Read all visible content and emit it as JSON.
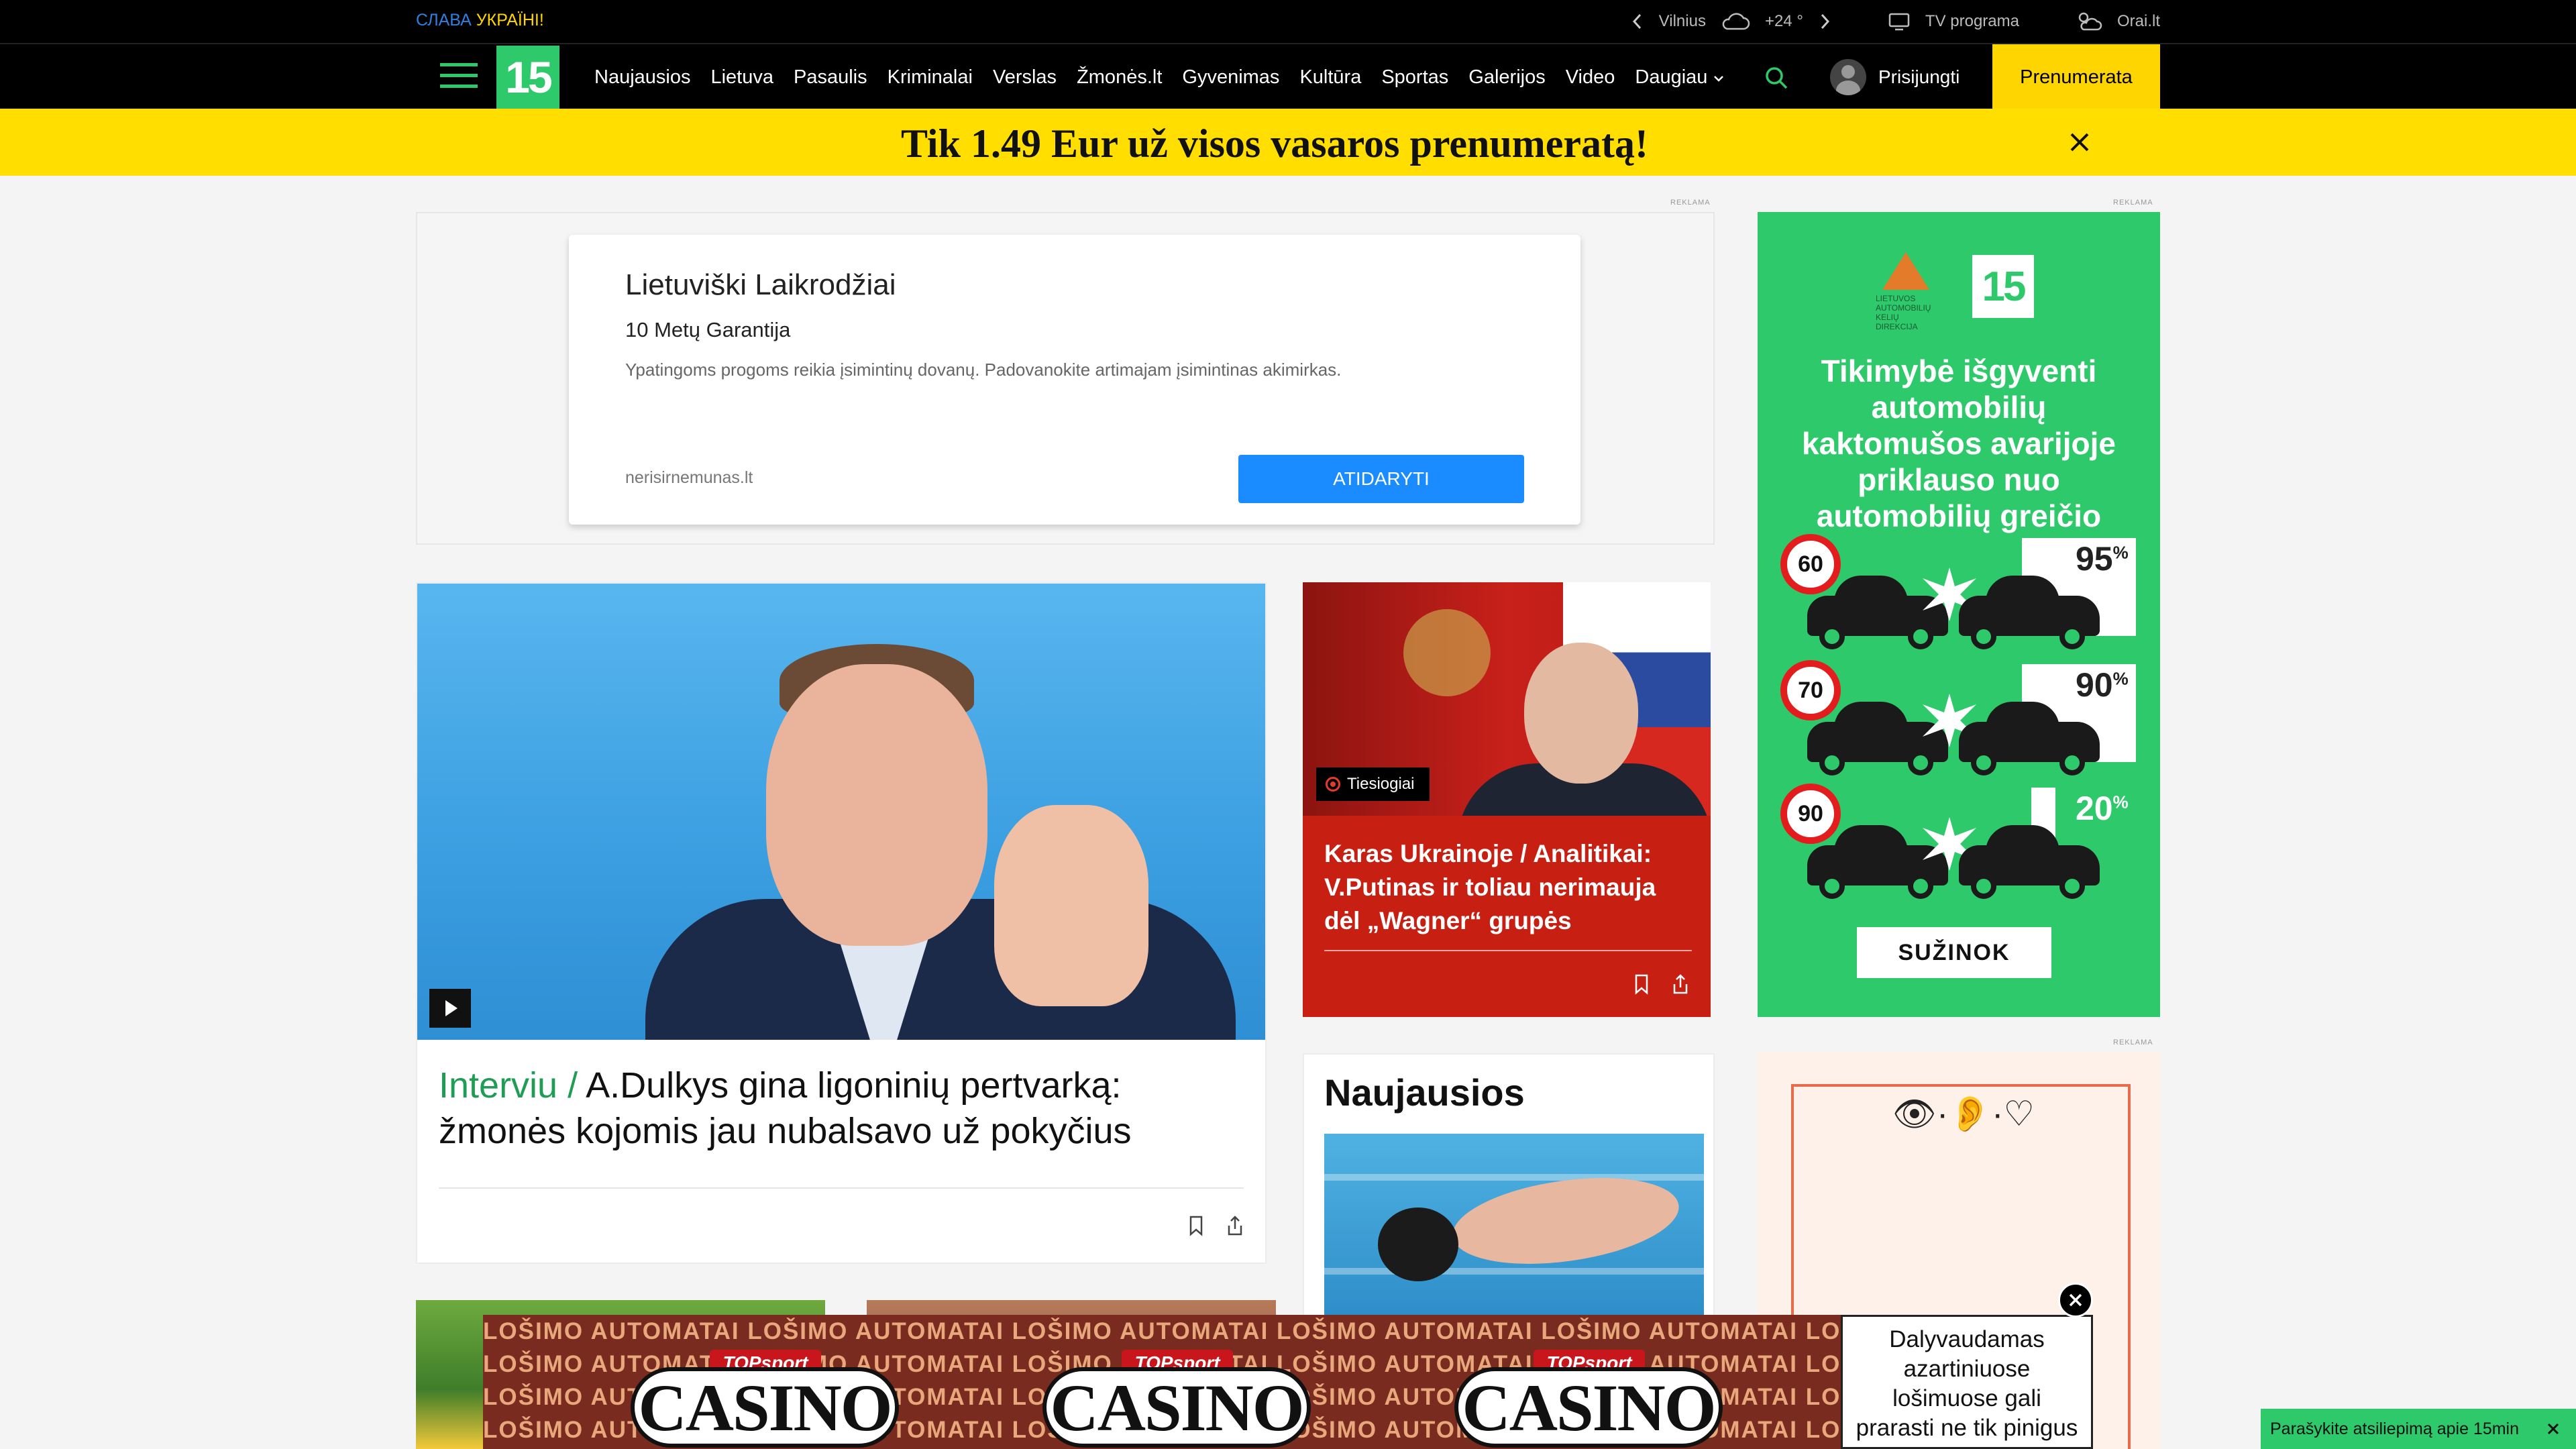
{
  "topbar": {
    "slava_blue": "СЛАВА",
    "slava_yellow": "УКРАЇНІ!",
    "weather_city": "Vilnius",
    "weather_temp": "+24 °",
    "tv_label": "TV programa",
    "orai_label": "Orai.lt"
  },
  "nav": {
    "logo": "15",
    "items": [
      "Naujausios",
      "Lietuva",
      "Pasaulis",
      "Kriminalai",
      "Verslas",
      "Žmonės.lt",
      "Gyvenimas",
      "Kultūra",
      "Sportas",
      "Galerijos",
      "Video",
      "Daugiau"
    ],
    "login": "Prisijungti",
    "subscribe": "Prenumerata"
  },
  "promo": {
    "text": "Tik 1.49 Eur už visos vasaros prenumeratą!"
  },
  "ad_label": "REKLAMA",
  "ad": {
    "title": "Lietuviški Laikrodžiai",
    "subtitle": "10 Metų Garantija",
    "description": "Ypatingoms progoms reikia įsimintinų dovanų. Padovanokite artimajam įsimintinas akimirkas.",
    "domain": "nerisirnemunas.lt",
    "button": "ATIDARYTI"
  },
  "main_article": {
    "category": "Interviu /",
    "title": "A.Dulkys gina ligoninių pertvarką: žmonės kojomis jau nubalsavo už pokyčius"
  },
  "live_article": {
    "badge": "Tiesiogiai",
    "title": "Karas Ukrainoje / Analitikai: V.Putinas ir toliau nerimauja dėl „Wagner“ grupės"
  },
  "naujausios": {
    "title": "Naujausios"
  },
  "side_ad": {
    "org": "LIETUVOS AUTOMOBILIŲ KELIŲ DIREKCIJA",
    "logo": "15",
    "headline": "Tikimybė išgyventi automobilių kaktomušos avarijoje priklauso nuo automobilių greičio",
    "rows": [
      {
        "speed": "60",
        "percent": "95",
        "pct_sign": "%"
      },
      {
        "speed": "70",
        "percent": "90",
        "pct_sign": "%"
      },
      {
        "speed": "90",
        "percent": "20",
        "pct_sign": "%"
      }
    ],
    "button": "SUŽINOK"
  },
  "side_ad2": {
    "symbols": "👁·👂·♡"
  },
  "casino": {
    "stripe_text": "LOŠIMO AUTOMATAI LOŠIMO AUTOMATAI LOŠIMO AUTOMATAI LOŠIMO AUTOMATAI LOŠIMO AUTOMATAI LOŠIMO AUTOMATAI LOŠIMO AUTOMATAI",
    "brand_top": "TOPsport",
    "brand_word": "CASINO",
    "warning": "Dalyvaudamas azartiniuose lošimuose gali prarasti ne tik pinigus"
  },
  "feedback": {
    "text": "Parašykite atsiliepimą apie 15min"
  }
}
